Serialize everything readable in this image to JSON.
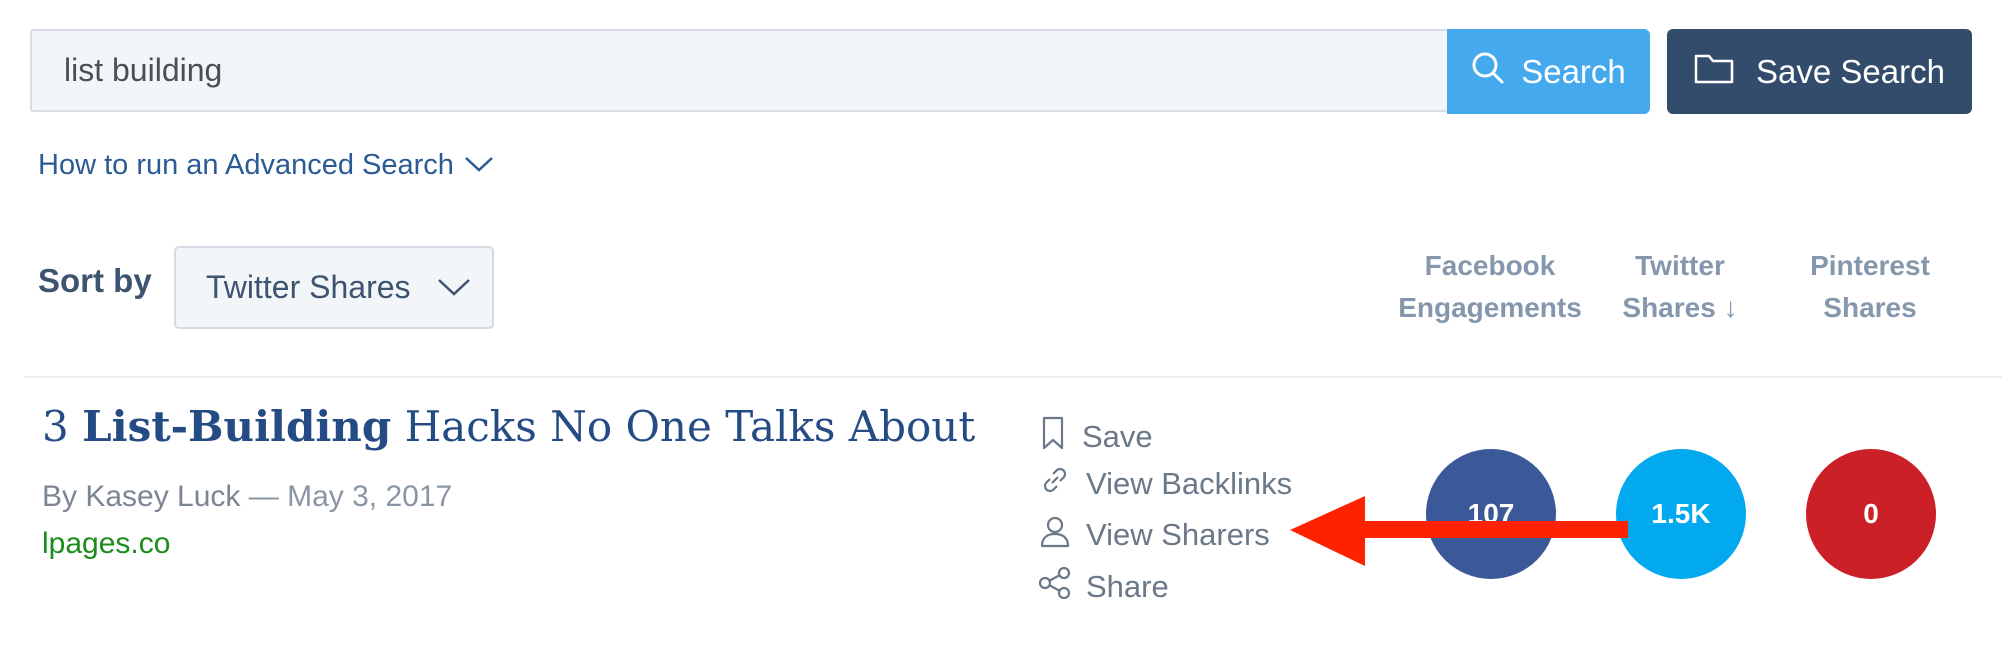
{
  "search": {
    "value": "list building",
    "button_label": "Search",
    "save_label": "Save Search"
  },
  "advanced": {
    "label": "How to run an Advanced Search"
  },
  "sort": {
    "label": "Sort by",
    "selected": "Twitter Shares"
  },
  "columns": {
    "facebook": [
      "Facebook",
      "Engagements"
    ],
    "twitter": [
      "Twitter",
      "Shares ↓"
    ],
    "pinterest": [
      "Pinterest",
      "Shares"
    ]
  },
  "result": {
    "title_prefix": "3 ",
    "title_bold": "List-Building",
    "title_suffix": " Hacks No One Talks About",
    "author": "By Kasey Luck",
    "separator": " — ",
    "date": "May 3, 2017",
    "domain": "lpages.co",
    "actions": {
      "save": "Save",
      "backlinks": "View Backlinks",
      "sharers": "View Sharers",
      "share": "Share"
    },
    "counts": {
      "facebook": "107",
      "twitter": "1.5K",
      "pinterest": "0"
    }
  },
  "colors": {
    "facebook": "#3b5998",
    "twitter": "#03a9ee",
    "pinterest": "#cb2027",
    "annotation_arrow": "#ff2200",
    "search_button": "#45a9ee",
    "save_button": "#344c6c"
  },
  "icons": [
    "search-icon",
    "folder-icon",
    "chevron-down-icon",
    "bookmark-icon",
    "link-icon",
    "user-icon",
    "share-icon"
  ]
}
